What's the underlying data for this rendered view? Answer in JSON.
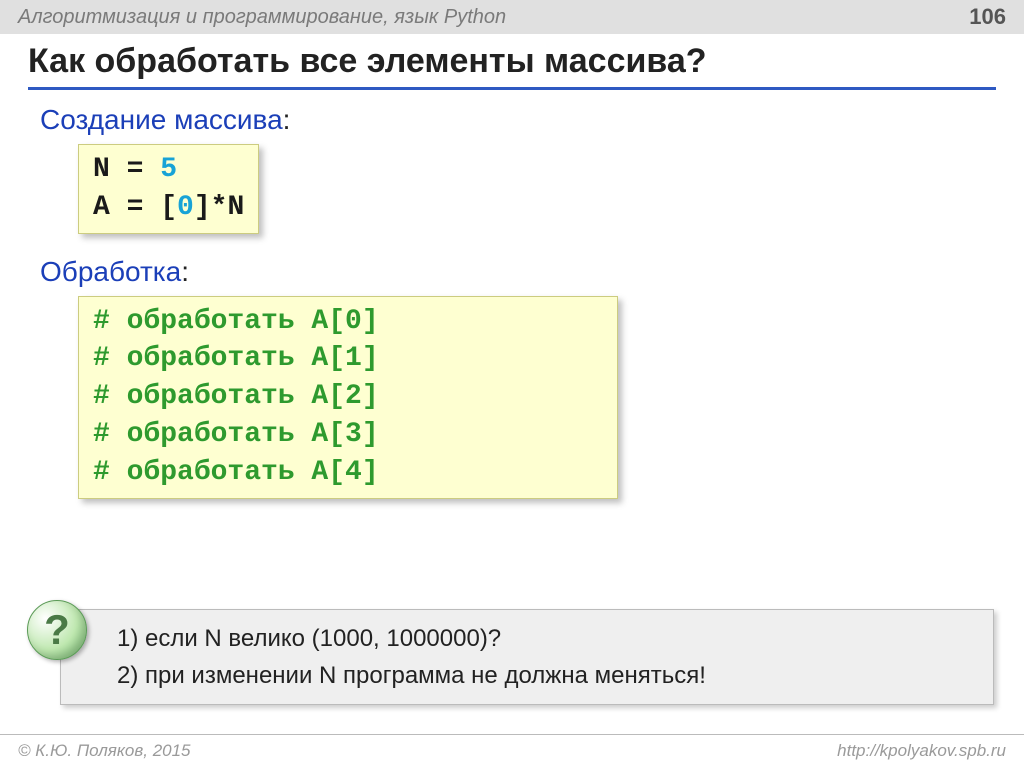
{
  "header": {
    "subject": "Алгоритмизация и программирование, язык Python",
    "page": "106"
  },
  "title": "Как обработать все элементы массива?",
  "section1": {
    "heading": "Создание массива",
    "code": {
      "l1a": "N",
      "l1b": " = ",
      "l1c": "5",
      "l2a": "A",
      "l2b": " = [",
      "l2c": "0",
      "l2d": "]*N"
    }
  },
  "section2": {
    "heading": "Обработка",
    "code": {
      "c0": "# обработать A[0]",
      "c1": "# обработать A[1]",
      "c2": "# обработать A[2]",
      "c3": "# обработать A[3]",
      "c4": "# обработать A[4]"
    }
  },
  "question": {
    "icon": "?",
    "line1": "1) если N велико (1000, 1000000)?",
    "line2": "2) при изменении N программа не должна меняться!"
  },
  "footer": {
    "left": "© К.Ю. Поляков, 2015",
    "right": "http://kpolyakov.spb.ru"
  }
}
